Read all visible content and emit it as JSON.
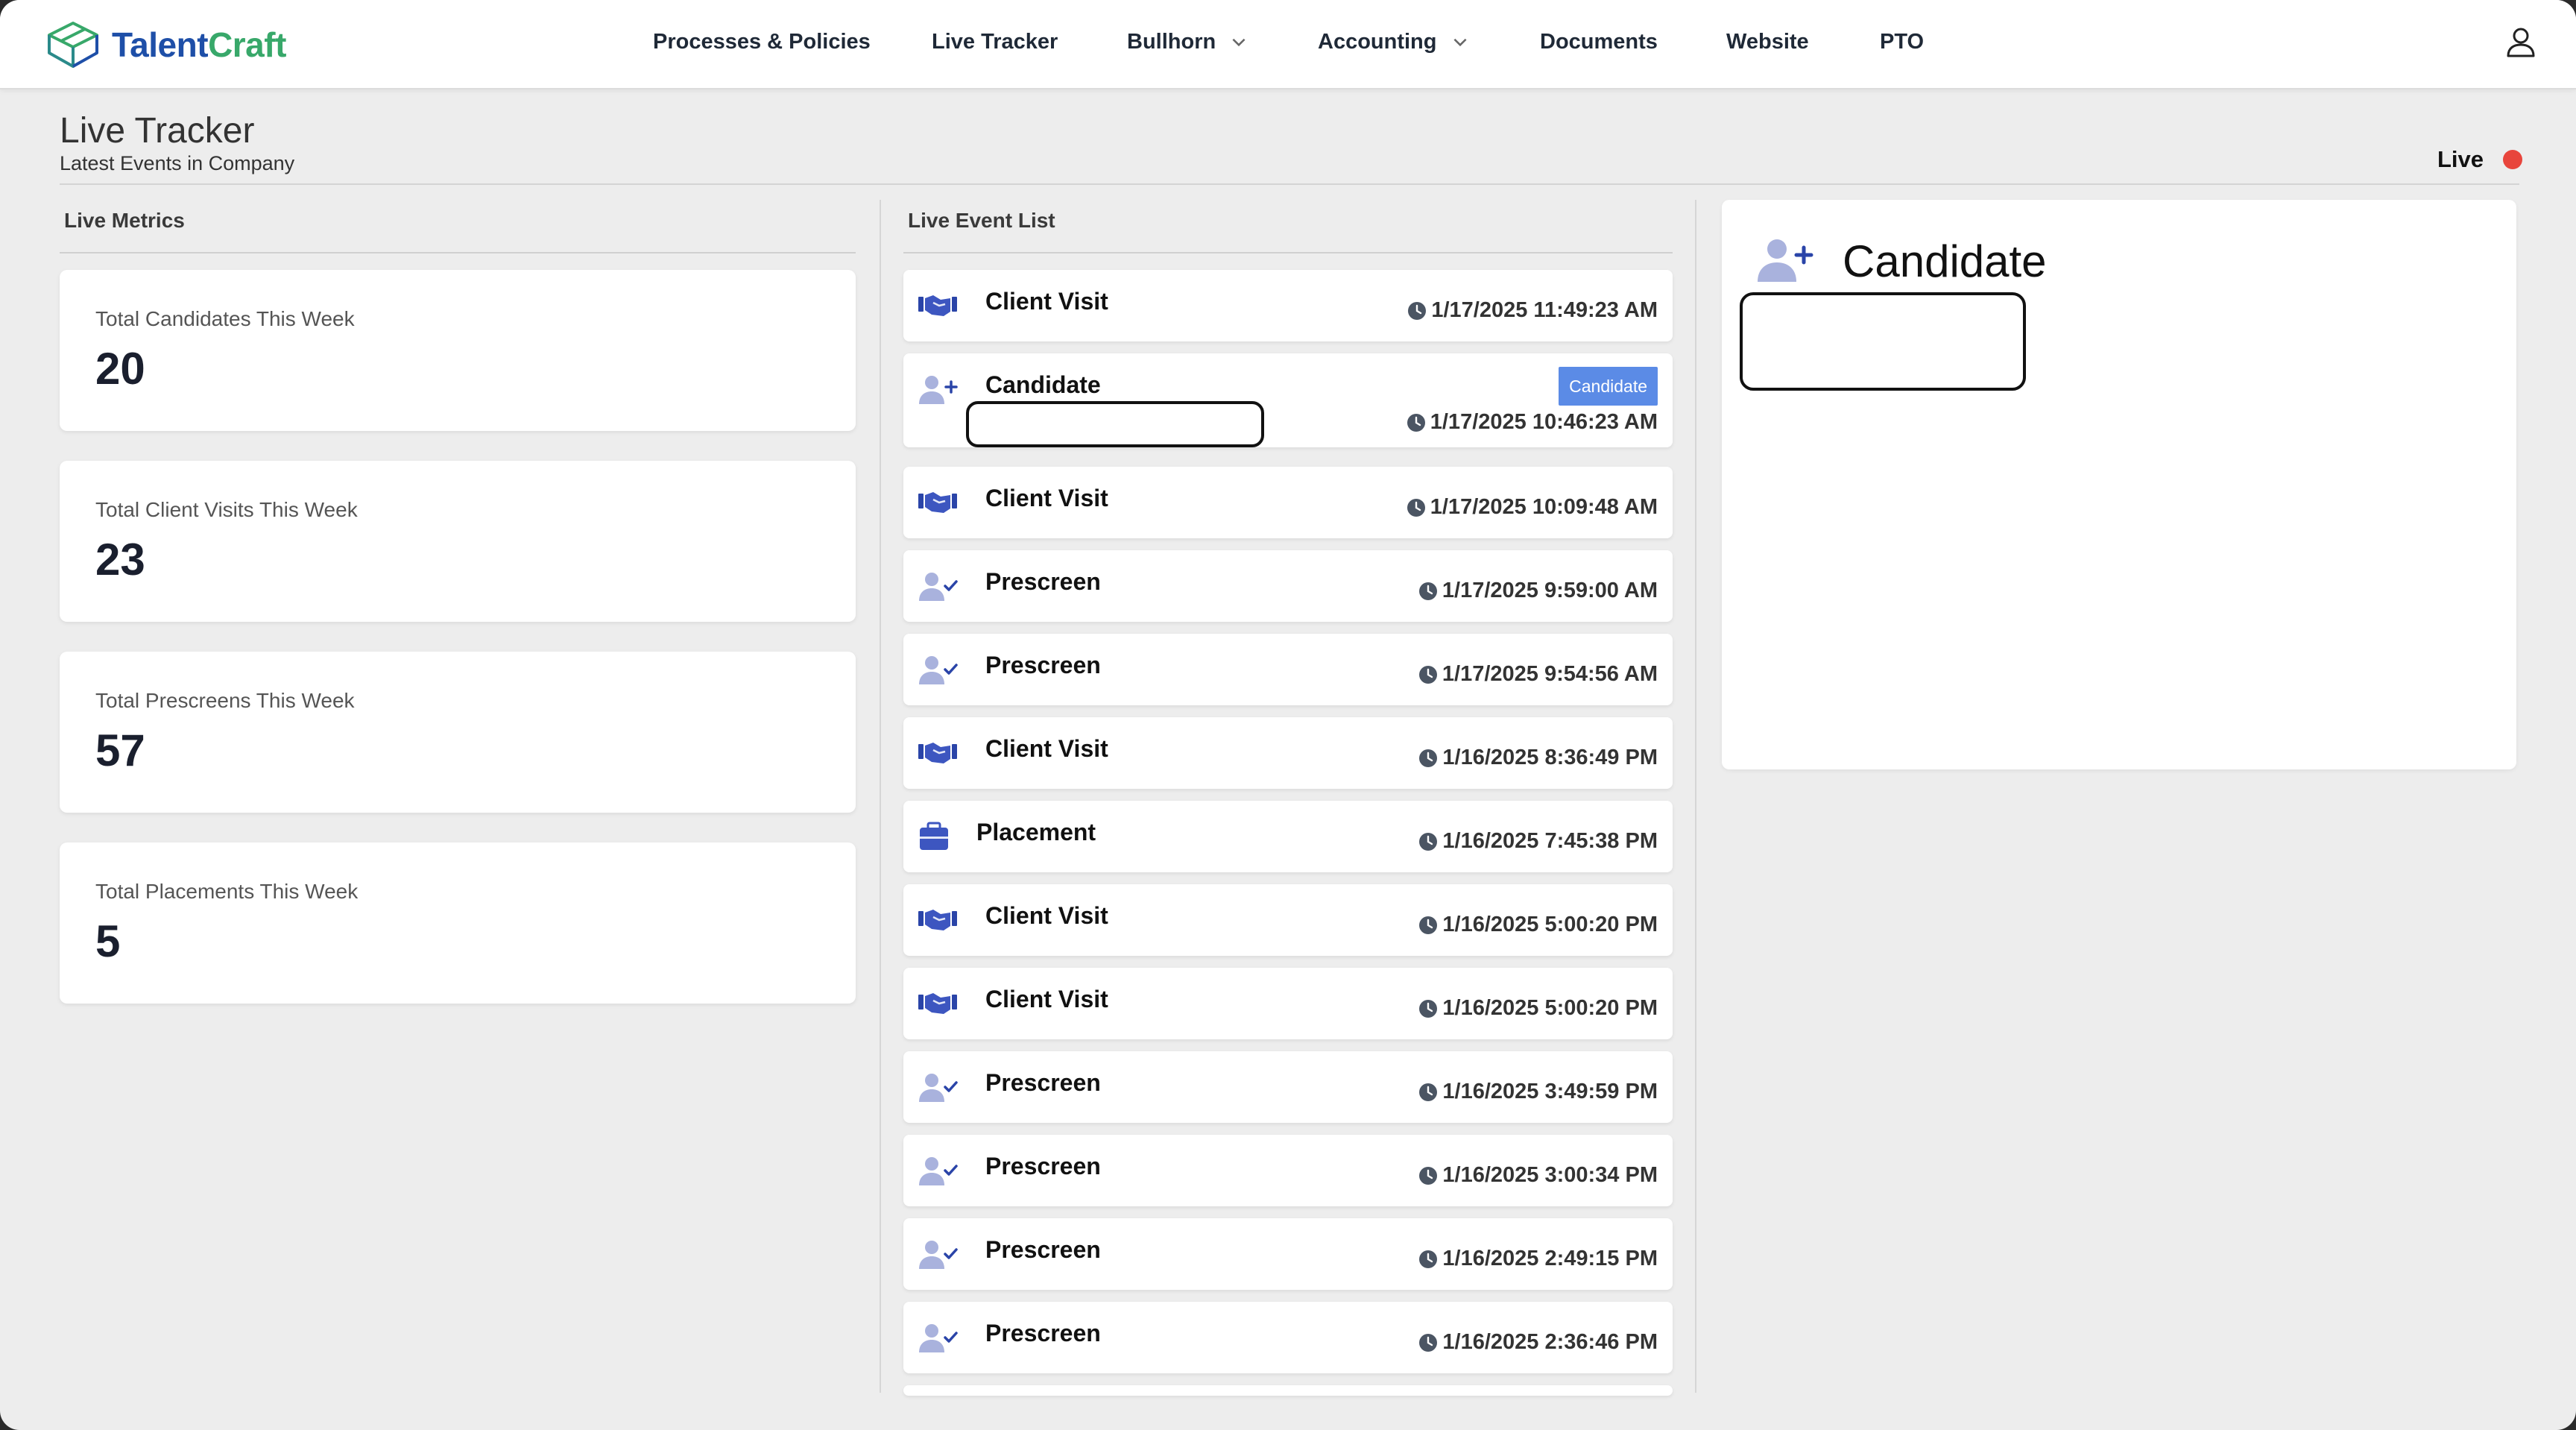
{
  "brand": {
    "name_part1": "Talent",
    "name_part2": "Craft",
    "color_primary": "#1e4fa8",
    "color_secondary": "#38a86a"
  },
  "nav": {
    "items": [
      {
        "label": "Processes & Policies",
        "has_dropdown": false
      },
      {
        "label": "Live Tracker",
        "has_dropdown": false
      },
      {
        "label": "Bullhorn",
        "has_dropdown": true
      },
      {
        "label": "Accounting",
        "has_dropdown": true
      },
      {
        "label": "Documents",
        "has_dropdown": false
      },
      {
        "label": "Website",
        "has_dropdown": false
      },
      {
        "label": "PTO",
        "has_dropdown": false
      }
    ],
    "user_icon": "user-icon"
  },
  "header": {
    "title": "Live Tracker",
    "subtitle": "Latest Events in Company",
    "live_label": "Live",
    "live_color": "#e8453c"
  },
  "metrics": {
    "title": "Live Metrics",
    "cards": [
      {
        "label": "Total Candidates This Week",
        "value": "20"
      },
      {
        "label": "Total Client Visits This Week",
        "value": "23"
      },
      {
        "label": "Total Prescreens This Week",
        "value": "57"
      },
      {
        "label": "Total Placements This Week",
        "value": "5"
      }
    ]
  },
  "events": {
    "title": "Live Event List",
    "items": [
      {
        "type": "Client Visit",
        "icon": "handshake-icon",
        "time": "1/17/2025 11:49:23 AM"
      },
      {
        "type": "Candidate",
        "icon": "user-plus-icon",
        "time": "1/17/2025 10:46:23 AM",
        "badge": "Candidate"
      },
      {
        "type": "Client Visit",
        "icon": "handshake-icon",
        "time": "1/17/2025 10:09:48 AM"
      },
      {
        "type": "Prescreen",
        "icon": "user-check-icon",
        "time": "1/17/2025 9:59:00 AM"
      },
      {
        "type": "Prescreen",
        "icon": "user-check-icon",
        "time": "1/17/2025 9:54:56 AM"
      },
      {
        "type": "Client Visit",
        "icon": "handshake-icon",
        "time": "1/16/2025 8:36:49 PM"
      },
      {
        "type": "Placement",
        "icon": "briefcase-icon",
        "time": "1/16/2025 7:45:38 PM"
      },
      {
        "type": "Client Visit",
        "icon": "handshake-icon",
        "time": "1/16/2025 5:00:20 PM"
      },
      {
        "type": "Client Visit",
        "icon": "handshake-icon",
        "time": "1/16/2025 5:00:20 PM"
      },
      {
        "type": "Prescreen",
        "icon": "user-check-icon",
        "time": "1/16/2025 3:49:59 PM"
      },
      {
        "type": "Prescreen",
        "icon": "user-check-icon",
        "time": "1/16/2025 3:00:34 PM"
      },
      {
        "type": "Prescreen",
        "icon": "user-check-icon",
        "time": "1/16/2025 2:49:15 PM"
      },
      {
        "type": "Prescreen",
        "icon": "user-check-icon",
        "time": "1/16/2025 2:36:46 PM"
      }
    ]
  },
  "detail": {
    "title": "Candidate",
    "icon": "user-plus-icon"
  }
}
